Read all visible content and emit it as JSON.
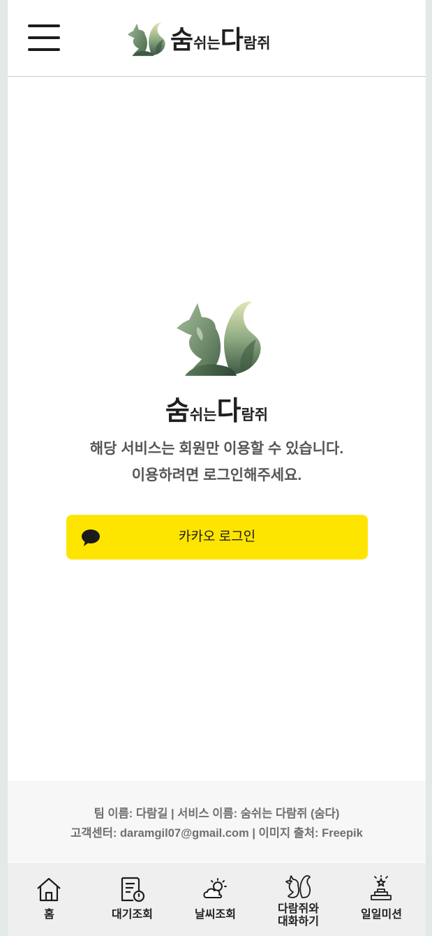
{
  "header": {
    "logo": {
      "part1": "숨",
      "part2": "쉬는",
      "part3": "다",
      "part4": "람쥐"
    }
  },
  "main": {
    "logo": {
      "part1": "숨",
      "part2": "쉬는",
      "part3": "다",
      "part4": "람쥐"
    },
    "notice_line1": "해당 서비스는 회원만 이용할 수 있습니다.",
    "notice_line2": "이용하려면 로그인해주세요.",
    "kakao_login_label": "카카오 로그인"
  },
  "footer": {
    "line1": "팀 이름: 다람길 | 서비스 이름: 숨쉬는 다람쥐 (숨다)",
    "line2": "고객센터: daramgil07@gmail.com | 이미지 출처: Freepik"
  },
  "bottom_nav": {
    "items": [
      {
        "label": "홈",
        "icon": "home-icon"
      },
      {
        "label": "대기조회",
        "icon": "air-quality-document-icon"
      },
      {
        "label": "날씨조회",
        "icon": "weather-icon"
      },
      {
        "label_line1": "다람쥐와",
        "label_line2": "대화하기",
        "icon": "squirrel-icon"
      },
      {
        "label": "일일미션",
        "icon": "mission-trophy-icon"
      }
    ]
  },
  "colors": {
    "brand_green": "#5e7d5a",
    "kakao_yellow": "#fee500",
    "text_dark": "#1f1f1f",
    "text_gray": "#555555"
  }
}
